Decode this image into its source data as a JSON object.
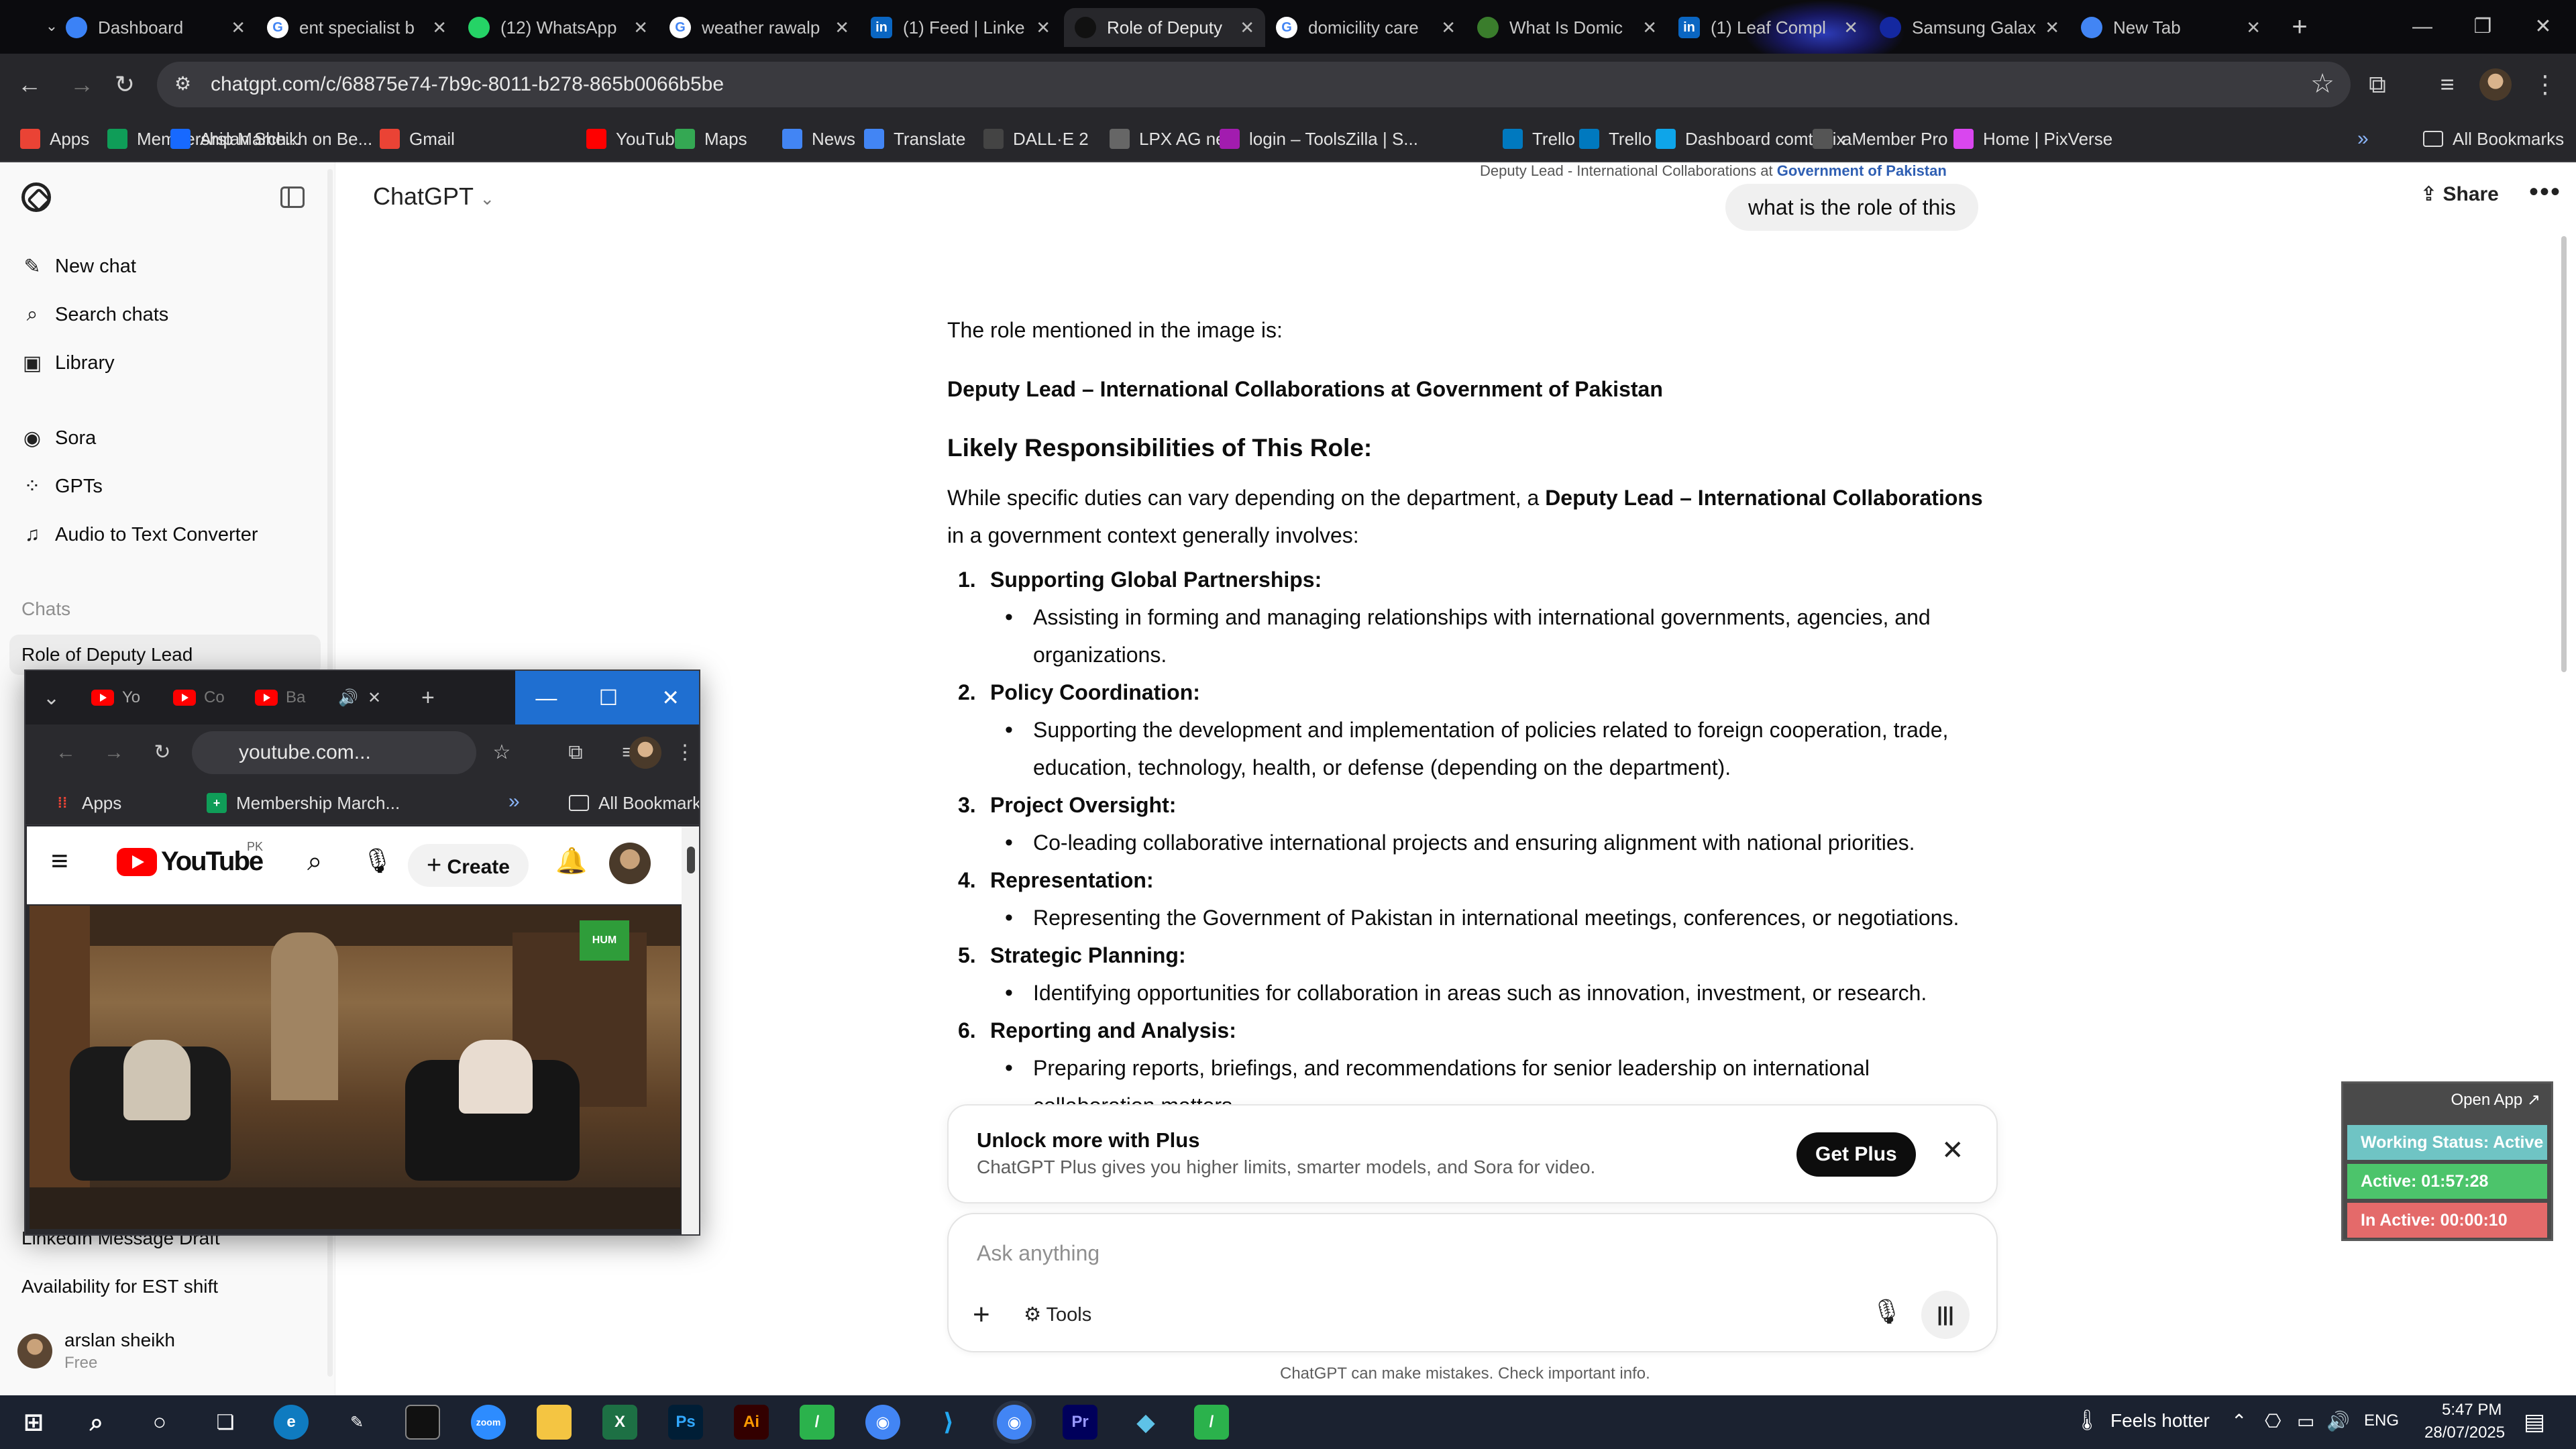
{
  "browser": {
    "tabs": [
      {
        "title": "Dashboard",
        "icon": "globe-icon",
        "color": "#3b82f6"
      },
      {
        "title": "ent specialist b",
        "icon": "google-icon",
        "color": "#ffffff"
      },
      {
        "title": "(12) WhatsApp",
        "icon": "whatsapp-icon",
        "color": "#25d366"
      },
      {
        "title": "weather rawalp",
        "icon": "google-icon",
        "color": "#ffffff"
      },
      {
        "title": "(1) Feed | Linke",
        "icon": "linkedin-icon",
        "color": "#0a66c2"
      },
      {
        "title": "Role of Deputy",
        "icon": "chatgpt-icon",
        "color": "#111111"
      },
      {
        "title": "domicility care",
        "icon": "google-icon",
        "color": "#ffffff"
      },
      {
        "title": "What Is Domic",
        "icon": "leaf-icon",
        "color": "#3a7d2c"
      },
      {
        "title": "(1) Leaf Compl",
        "icon": "linkedin-icon",
        "color": "#0a66c2"
      },
      {
        "title": "Samsung Galax",
        "icon": "samsung-icon",
        "color": "#1428a0"
      },
      {
        "title": "New Tab",
        "icon": "chrome-icon",
        "color": "#4285f4"
      }
    ],
    "url": "chatgpt.com/c/68875e74-7b9c-8011-b278-865b0066b5be",
    "bookmarks": [
      {
        "label": "Apps",
        "icon": "apps-grid-icon"
      },
      {
        "label": "Membership March...",
        "icon": "sheets-icon"
      },
      {
        "label": "Arslan Sheikh on Be...",
        "icon": "behance-icon"
      },
      {
        "label": "Gmail",
        "icon": "gmail-icon"
      },
      {
        "label": "YouTube",
        "icon": "youtube-icon"
      },
      {
        "label": "Maps",
        "icon": "maps-icon"
      },
      {
        "label": "News",
        "icon": "news-icon"
      },
      {
        "label": "Translate",
        "icon": "translate-icon"
      },
      {
        "label": "DALL·E 2",
        "icon": "openai-icon"
      },
      {
        "label": "LPX AG new",
        "icon": "dots-icon"
      },
      {
        "label": "login – ToolsZilla | S...",
        "icon": "toolszilla-icon"
      },
      {
        "label": "Trello",
        "icon": "trello-icon"
      },
      {
        "label": "Trello",
        "icon": "trello-icon"
      },
      {
        "label": "Dashboard comtanix",
        "icon": "comtanix-icon"
      },
      {
        "label": "aMember Pro",
        "icon": "amember-icon"
      },
      {
        "label": "Home | PixVerse",
        "icon": "pixverse-icon"
      }
    ],
    "all_bookmarks": "All Bookmarks"
  },
  "sidebar": {
    "nav": [
      {
        "label": "New chat",
        "icon": "pencil-icon"
      },
      {
        "label": "Search chats",
        "icon": "search-icon"
      },
      {
        "label": "Library",
        "icon": "library-icon"
      }
    ],
    "apps": [
      {
        "label": "Sora",
        "icon": "sora-icon"
      },
      {
        "label": "GPTs",
        "icon": "gpts-grid-icon"
      },
      {
        "label": "Audio to Text Converter",
        "icon": "gpt-app-icon"
      }
    ],
    "chats_heading": "Chats",
    "chats": [
      "Role of Deputy Lead",
      "LinkedIn Message Draft",
      "Availability for EST shift"
    ],
    "user": {
      "name": "arslan sheikh",
      "plan": "Free"
    }
  },
  "main": {
    "model": "ChatGPT",
    "share": "Share",
    "prev_caption_prefix": "Deputy Lead - International Collaborations at",
    "prev_caption_link": "Government of Pakistan",
    "user_message": "what is the role of this",
    "answer": {
      "intro": "The role mentioned in the image is:",
      "role": "Deputy Lead – International Collaborations at Government of Pakistan",
      "heading": "Likely Responsibilities of This Role:",
      "lead_prefix": "While specific duties can vary depending on the department, a",
      "lead_bold": "Deputy Lead – International Collaborations",
      "lead_suffix": "in a government context generally involves:",
      "items": [
        {
          "num": "1.",
          "head": "Supporting Global Partnerships:",
          "text": "Assisting in forming and managing relationships with international governments, agencies, and organizations."
        },
        {
          "num": "2.",
          "head": "Policy Coordination:",
          "text": "Supporting the development and implementation of policies related to foreign cooperation, trade, education, technology, health, or defense (depending on the department)."
        },
        {
          "num": "3.",
          "head": "Project Oversight:",
          "text": "Co-leading collaborative international projects and ensuring alignment with national priorities."
        },
        {
          "num": "4.",
          "head": "Representation:",
          "text": "Representing the Government of Pakistan in international meetings, conferences, or negotiations."
        },
        {
          "num": "5.",
          "head": "Strategic Planning:",
          "text": "Identifying opportunities for collaboration in areas such as innovation, investment, or research."
        },
        {
          "num": "6.",
          "head": "Reporting and Analysis:",
          "text": "Preparing reports, briefings, and recommendations for senior leadership on international collaboration matters."
        }
      ]
    },
    "upsell": {
      "title": "Unlock more with Plus",
      "desc": "ChatGPT Plus gives you higher limits, smarter models, and Sora for video.",
      "button": "Get Plus"
    },
    "composer": {
      "placeholder": "Ask anything",
      "tools": "Tools"
    },
    "disclaimer": "ChatGPT can make mistakes. Check important info."
  },
  "mini_browser": {
    "tabs": [
      "Yo",
      "Co",
      "Ba"
    ],
    "url": "youtube.com...",
    "bookmarks": [
      {
        "label": "Apps"
      },
      {
        "label": "Membership March..."
      }
    ],
    "all_bookmarks": "All Bookmarks",
    "youtube": {
      "wordmark": "YouTube",
      "country": "PK",
      "create": "Create",
      "channel_badge": "HUM"
    }
  },
  "tracker": {
    "open_app": "Open App ↗",
    "working_status": "Working Status: Active",
    "active": "Active: 01:57:28",
    "inactive": "In Active: 00:00:10",
    "colors": {
      "working": "#6fc4c4",
      "active": "#4cc46b",
      "inactive": "#e46a6a"
    }
  },
  "taskbar": {
    "weather": "Feels hotter",
    "lang": "ENG",
    "time": "5:47 PM",
    "date": "28/07/2025"
  }
}
